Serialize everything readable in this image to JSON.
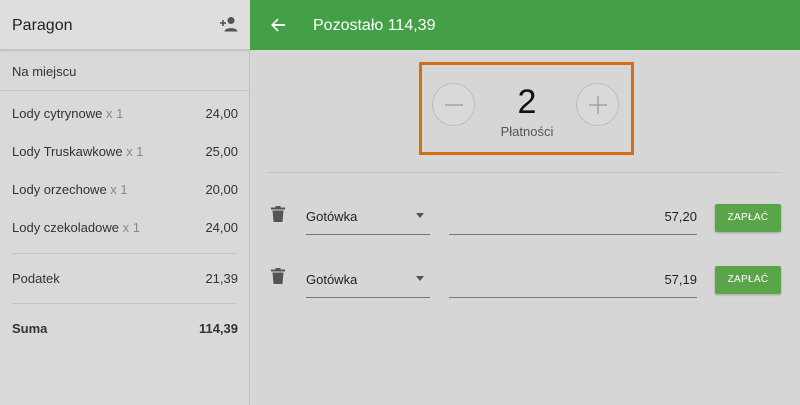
{
  "receipt": {
    "title": "Paragon",
    "order_type": "Na miejscu",
    "items": [
      {
        "name": "Lody cytrynowe",
        "qty": "x 1",
        "price": "24,00"
      },
      {
        "name": "Lody Truskawkowe",
        "qty": "x 1",
        "price": "25,00"
      },
      {
        "name": "Lody orzechowe",
        "qty": "x 1",
        "price": "20,00"
      },
      {
        "name": "Lody czekoladowe",
        "qty": "x 1",
        "price": "24,00"
      }
    ],
    "tax": {
      "label": "Podatek",
      "value": "21,39"
    },
    "total": {
      "label": "Suma",
      "value": "114,39"
    }
  },
  "appbar": {
    "title": "Pozostało 114,39",
    "accent": "#43a047"
  },
  "payments_counter": {
    "count": "2",
    "label": "Płatności",
    "highlight_color": "#d66d13"
  },
  "payments": [
    {
      "method": "Gotówka",
      "amount": "57,20",
      "pay_label": "ZAPŁAĆ"
    },
    {
      "method": "Gotówka",
      "amount": "57,19",
      "pay_label": "ZAPŁAĆ"
    }
  ],
  "icons": {
    "add_person": "person-add-icon",
    "back": "arrow-back-icon",
    "minus": "minus-icon",
    "plus": "plus-icon",
    "delete": "trash-icon",
    "dropdown": "caret-down-icon"
  }
}
